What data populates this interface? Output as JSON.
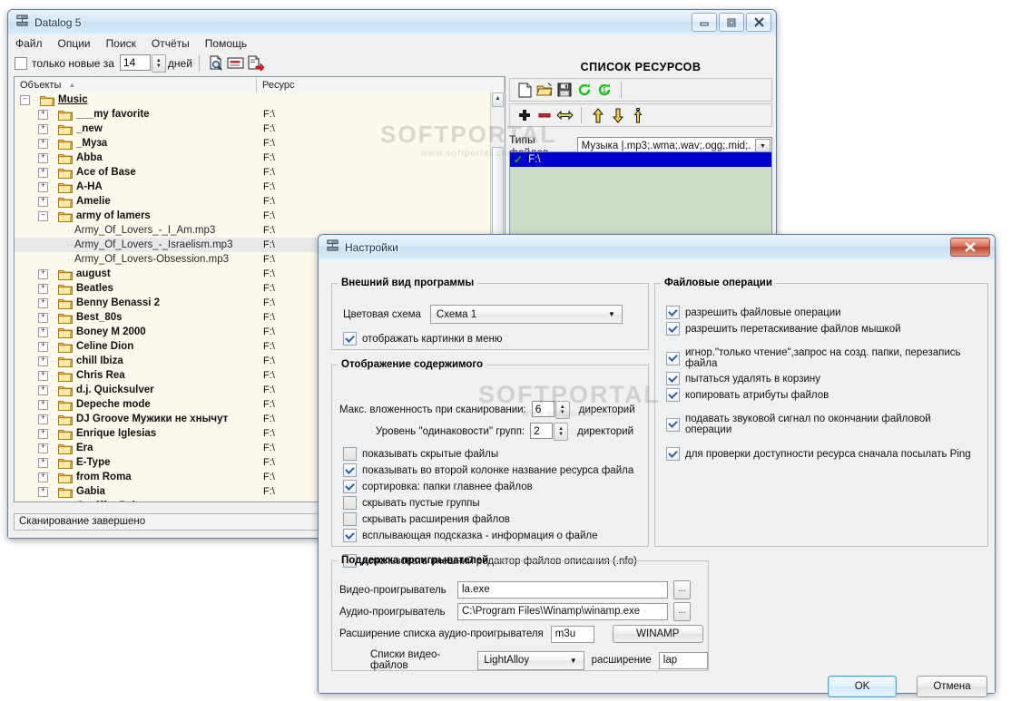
{
  "main_window": {
    "title": "Datalog 5",
    "icon": "app-datalog-icon",
    "titlebar_buttons": {
      "minimize": "–",
      "maximize": "□",
      "close": "✕"
    },
    "menu": [
      "Файл",
      "Опции",
      "Поиск",
      "Отчёты",
      "Помощь"
    ],
    "toolbar": {
      "only_new_label": "только новые за",
      "only_new_checked": false,
      "days_value": "14",
      "days_label": "дней",
      "icons": [
        "find-document-icon",
        "card-view-icon",
        "export-document-icon"
      ]
    },
    "list": {
      "columns": [
        "Объекты",
        "Ресурс"
      ],
      "sort_indicator": "▲",
      "resource_value": "F:\\",
      "rows": [
        {
          "label": "Music",
          "type": "root",
          "state": "minus",
          "indent": 0,
          "resource": ""
        },
        {
          "label": "___my favorite",
          "type": "dir",
          "state": "plus",
          "indent": 1,
          "resource": "F:\\"
        },
        {
          "label": "_new",
          "type": "dir",
          "state": "plus",
          "indent": 1,
          "resource": "F:\\"
        },
        {
          "label": "_Муза",
          "type": "dir",
          "state": "plus",
          "indent": 1,
          "resource": "F:\\"
        },
        {
          "label": "Abba",
          "type": "dir",
          "state": "plus",
          "indent": 1,
          "resource": "F:\\"
        },
        {
          "label": "Ace of Base",
          "type": "dir",
          "state": "plus",
          "indent": 1,
          "resource": "F:\\"
        },
        {
          "label": "A-HA",
          "type": "dir",
          "state": "plus",
          "indent": 1,
          "resource": "F:\\"
        },
        {
          "label": "Amelie",
          "type": "dir",
          "state": "plus",
          "indent": 1,
          "resource": "F:\\"
        },
        {
          "label": "army of lamers",
          "type": "dir",
          "state": "minus",
          "indent": 1,
          "resource": "F:\\"
        },
        {
          "label": "Army_Of_Lovers_-_I_Am.mp3",
          "type": "file",
          "state": "none",
          "indent": 2,
          "resource": "F:\\"
        },
        {
          "label": "Army_Of_Lovers_-_Israelism.mp3",
          "type": "file",
          "state": "none",
          "indent": 2,
          "resource": "F:\\",
          "highlight": true
        },
        {
          "label": "Army_Of_Lovers-Obsession.mp3",
          "type": "file",
          "state": "none",
          "indent": 2,
          "resource": "F:\\"
        },
        {
          "label": "august",
          "type": "dir",
          "state": "plus",
          "indent": 1,
          "resource": "F:\\"
        },
        {
          "label": "Beatles",
          "type": "dir",
          "state": "plus",
          "indent": 1,
          "resource": "F:\\"
        },
        {
          "label": "Benny Benassi 2",
          "type": "dir",
          "state": "plus",
          "indent": 1,
          "resource": "F:\\"
        },
        {
          "label": "Best_80s",
          "type": "dir",
          "state": "plus",
          "indent": 1,
          "resource": "F:\\"
        },
        {
          "label": "Boney M 2000",
          "type": "dir",
          "state": "plus",
          "indent": 1,
          "resource": "F:\\"
        },
        {
          "label": "Celine Dion",
          "type": "dir",
          "state": "plus",
          "indent": 1,
          "resource": "F:\\"
        },
        {
          "label": "chill Ibiza",
          "type": "dir",
          "state": "plus",
          "indent": 1,
          "resource": "F:\\"
        },
        {
          "label": "Chris Rea",
          "type": "dir",
          "state": "plus",
          "indent": 1,
          "resource": "F:\\"
        },
        {
          "label": "d.j. Quicksulver",
          "type": "dir",
          "state": "plus",
          "indent": 1,
          "resource": "F:\\"
        },
        {
          "label": "Depeche mode",
          "type": "dir",
          "state": "plus",
          "indent": 1,
          "resource": "F:\\"
        },
        {
          "label": "DJ Groove Мужики не хнычут",
          "type": "dir",
          "state": "plus",
          "indent": 1,
          "resource": "F:\\"
        },
        {
          "label": "Enrique Iglesias",
          "type": "dir",
          "state": "plus",
          "indent": 1,
          "resource": "F:\\"
        },
        {
          "label": "Era",
          "type": "dir",
          "state": "plus",
          "indent": 1,
          "resource": "F:\\"
        },
        {
          "label": "E-Type",
          "type": "dir",
          "state": "plus",
          "indent": 1,
          "resource": "F:\\"
        },
        {
          "label": "from Roma",
          "type": "dir",
          "state": "plus",
          "indent": 1,
          "resource": "F:\\"
        },
        {
          "label": "Gabia",
          "type": "dir",
          "state": "plus",
          "indent": 1,
          "resource": "F:\\"
        },
        {
          "label": "Geniffer Paige",
          "type": "dir",
          "state": "plus",
          "indent": 1,
          "resource": "F:\\"
        }
      ]
    },
    "status": "Сканирование завершено",
    "resources_panel": {
      "title": "СПИСОК РЕСУРСОВ",
      "toolbar_row1": [
        "new-file-icon",
        "open-folder-icon",
        "save-disk-icon",
        "refresh-all-icon",
        "refresh-one-icon"
      ],
      "toolbar_row2": [
        "add-plus-icon",
        "remove-minus-icon",
        "resize-horizontal-icon",
        "move-up-icon",
        "move-down-icon",
        "move-top-icon"
      ],
      "file_types_label": "Типы файлов",
      "file_types_value": "Музыка |.mp3;.wma;.wav;.ogg;.mid;.",
      "items": [
        {
          "label": "F:\\",
          "checked": true,
          "selected": true
        }
      ]
    }
  },
  "settings_dialog": {
    "title": "Настройки",
    "icon": "app-datalog-icon",
    "close_label": "✕",
    "appearance": {
      "legend": "Внешний вид программы",
      "scheme_label": "Цветовая схема",
      "scheme_value": "Схема 1",
      "show_menu_pictures": {
        "label": "отображать картинки в меню",
        "checked": true
      }
    },
    "content_display": {
      "legend": "Отображение содержимого",
      "max_depth_label": "Макс. вложенность при сканировании:",
      "max_depth_value": "6",
      "max_depth_unit": "директорий",
      "sameness_label": "Уровень \"одинаковости\" групп:",
      "sameness_value": "2",
      "sameness_unit": "директорий",
      "checks": [
        {
          "label": "показывать скрытые файлы",
          "checked": false
        },
        {
          "label": "показывать во второй колонке название ресурса файла",
          "checked": true
        },
        {
          "label": "сортировка: папки главнее файлов",
          "checked": true
        },
        {
          "label": "скрывать пустые группы",
          "checked": false
        },
        {
          "label": "скрывать расширения файлов",
          "checked": false
        },
        {
          "label": "всплывающая подсказка - информация о файле",
          "checked": true
        },
        {
          "label": "использовать внешний редактор файлов описания (.nfo)",
          "checked": false,
          "gap": true
        }
      ]
    },
    "file_operations": {
      "legend": "Файловые операции",
      "checks": [
        {
          "label": "разрешить файловые операции",
          "checked": true
        },
        {
          "label": "разрешить перетаскивание файлов мышкой",
          "checked": true
        },
        {
          "label": "игнор.\"только чтение\",запрос на созд. папки, перезапись файла",
          "checked": true,
          "gap": true
        },
        {
          "label": "пытаться удалять в корзину",
          "checked": true
        },
        {
          "label": "копировать атрибуты файлов",
          "checked": true
        },
        {
          "label": "подавать звуковой сигнал по окончании файловой операции",
          "checked": true,
          "gap": true
        },
        {
          "label": "для проверки доступности ресурса сначала посылать Ping",
          "checked": true,
          "gap": true
        }
      ]
    },
    "players": {
      "legend": "Поддержка проигрывателей",
      "video_label": "Видео-проигрыватель",
      "video_value": "la.exe",
      "audio_label": "Аудио-проигрыватель",
      "audio_value": "C:\\Program Files\\Winamp\\winamp.exe",
      "browse_label": "...",
      "audio_ext_label": "Расширение списка аудио-проигрывателя",
      "audio_ext_value": "m3u",
      "winamp_button": "WINAMP",
      "video_lists_label": "Списки видео-файлов",
      "video_lists_value": "LightAlloy",
      "video_ext_label": "расширение",
      "video_ext_value": "lap"
    },
    "ok_label": "OK",
    "cancel_label": "Отмена"
  },
  "watermark": {
    "text": "SOFTPORTAL",
    "sub": "www.softportal.com"
  }
}
